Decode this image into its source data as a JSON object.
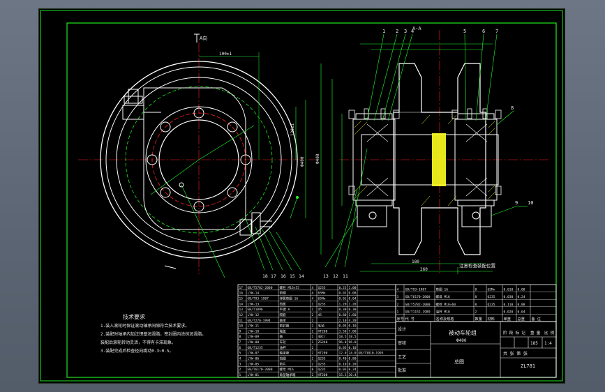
{
  "drawing": {
    "name": "被动车轮组",
    "subtitle": "Ф400",
    "sheet": "总图",
    "section_label": "A-A",
    "view_label": "A向",
    "stamp_left": "标记",
    "stamp_right": "比例",
    "scale_value": "1:4",
    "weight_value": "185",
    "drawing_no": "ZL781",
    "note_label": "注意检查装配位置"
  },
  "tech_notes": {
    "title": "技术要求",
    "lines": [
      "1.装入滚轮时保证滚动轴承间隙符合技术要求。",
      "2.装配时轴承内加注锂基润滑脂，密封圈内涂抹润滑脂。",
      "  装配后滚轮转动灵活，不得有卡滞现象。",
      "3.装配完成后检查径向跳动0.3~0.5。"
    ]
  },
  "callouts_top": [
    "1",
    "2",
    "3",
    "4",
    "5",
    "6",
    "7"
  ],
  "callouts_right": [
    "8",
    "9",
    "10"
  ],
  "callouts_bottom": [
    "18",
    "17",
    "16",
    "15",
    "14",
    "13",
    "12",
    "11"
  ],
  "colors": {
    "frame": "#1fe81f",
    "part": "#ffffff",
    "center": "#ff2020",
    "hatch": "#ffff20",
    "dim": "#20ff30",
    "text": "#e8e8e8"
  },
  "bom_left": {
    "rows": [
      [
        "17",
        "GB/T5782-2000",
        "螺栓 M16×55",
        "4",
        "Q235",
        "0.25",
        "1.00",
        ""
      ],
      [
        "16",
        "LYW-14",
        "垫圈",
        "4",
        "65Mn",
        "0.02",
        "0.08",
        ""
      ],
      [
        "15",
        "GB/T93-1987",
        "弹簧垫圈 16",
        "4",
        "65Mn",
        "0.01",
        "0.04",
        ""
      ],
      [
        "14",
        "LYW-13",
        "挡板",
        "1",
        "Q235",
        "1.20",
        "1.20",
        ""
      ],
      [
        "13",
        "GB/T1096",
        "平键 A",
        "1",
        "45",
        "0.30",
        "0.30",
        ""
      ],
      [
        "12",
        "LYW-12",
        "隔套",
        "2",
        "45",
        "0.80",
        "1.60",
        ""
      ],
      [
        "11",
        "GB/T276-1994",
        "轴承",
        "2",
        "",
        "2.10",
        "4.20",
        ""
      ],
      [
        "10",
        "LYW-11",
        "密封圈",
        "2",
        "毛毡",
        "0.05",
        "0.10",
        ""
      ],
      [
        "9",
        "LYW-10",
        "端盖",
        "2",
        "HT200",
        "3.50",
        "7.00",
        ""
      ],
      [
        "8",
        "LYW-09",
        "轴",
        "1",
        "40Cr",
        "18.5",
        "18.5",
        ""
      ],
      [
        "7",
        "LYW-08",
        "车轮",
        "1",
        "ZG340",
        "96.0",
        "96.0",
        ""
      ],
      [
        "6",
        "GB/T1235",
        "油杯",
        "2",
        "",
        "0.05",
        "0.10",
        ""
      ],
      [
        "5",
        "LYW-07",
        "轴承座",
        "2",
        "HT200",
        "12.0",
        "24.0",
        "GB/T3810-1995"
      ],
      [
        "4",
        "LYW-06",
        "挡圈",
        "2",
        "Q235",
        "0.40",
        "0.80",
        ""
      ],
      [
        "3",
        "LYW-05",
        "垫片",
        "2",
        "Q235",
        "0.10",
        "0.20",
        ""
      ],
      [
        "2",
        "GB/T6170-2000",
        "螺母 M16",
        "8",
        "Q235",
        "0.03",
        "0.24",
        ""
      ],
      [
        "1",
        "LYW-01",
        "角型轴承箱",
        "2",
        "HT200",
        "15.2",
        "30.4",
        ""
      ]
    ]
  },
  "bom_right": {
    "rows": [
      [
        "4",
        "GB/T93-1987",
        "垫圈 16",
        "8",
        "65Mn",
        "0.010",
        "0.08"
      ],
      [
        "3",
        "GB/T6170-2000",
        "螺母 M16",
        "8",
        "Q235",
        "0.030",
        "0.24"
      ],
      [
        "2",
        "GB/T5782-2000",
        "螺栓 M16×60",
        "8",
        "Q235",
        "0.110",
        "0.88"
      ],
      [
        "1",
        "GB/T1152-1989",
        "油杯 M10",
        "2",
        "",
        "0.020",
        "0.04"
      ]
    ],
    "header": [
      "序号",
      "代 号",
      "名称及规格",
      "数量",
      "材料",
      "单重",
      "总重",
      "备 注"
    ]
  },
  "title_block": {
    "row_labels": [
      "设计",
      "审核",
      "工艺",
      "批准"
    ],
    "stage_labels": [
      "阶 段 标 记",
      "重 量",
      "比 例"
    ],
    "sheet_info": "共 张 第 张"
  }
}
